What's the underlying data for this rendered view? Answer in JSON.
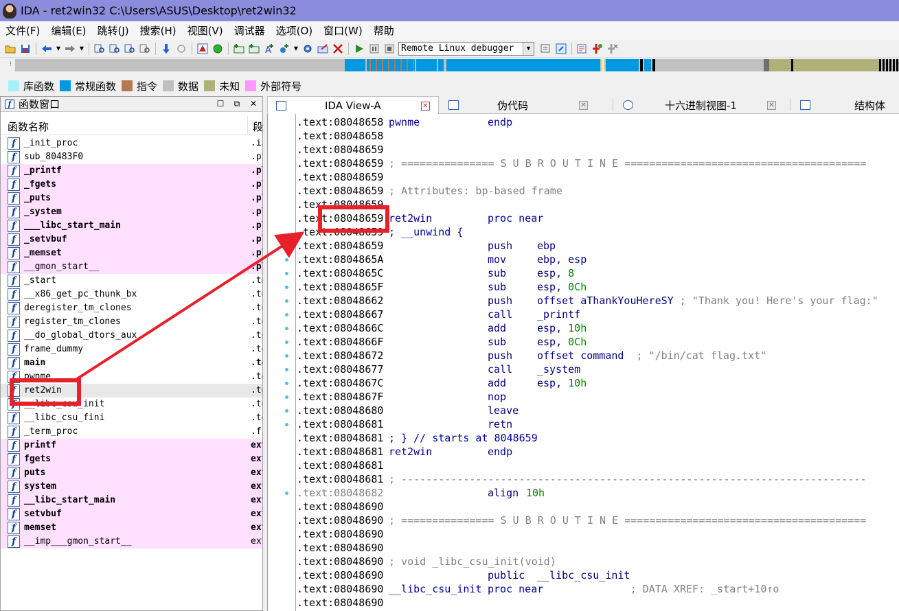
{
  "window": {
    "title": "IDA - ret2win32 C:\\Users\\ASUS\\Desktop\\ret2win32"
  },
  "menu": [
    "文件(F)",
    "编辑(E)",
    "跳转(J)",
    "搜索(H)",
    "视图(V)",
    "调试器",
    "选项(O)",
    "窗口(W)",
    "帮助"
  ],
  "toolbar": {
    "debugger_selected": "Remote Linux debugger"
  },
  "legend": [
    {
      "label": "库函数",
      "color": "#a8f0f8"
    },
    {
      "label": "常规函数",
      "color": "#0099e0"
    },
    {
      "label": "指令",
      "color": "#b87850"
    },
    {
      "label": "数据",
      "color": "#c0c0c0"
    },
    {
      "label": "未知",
      "color": "#b0b078"
    },
    {
      "label": "外部符号",
      "color": "#ff99ff"
    }
  ],
  "functions_window": {
    "title": "函数窗口",
    "col_name": "函数名称",
    "col_segment": "段",
    "rows": [
      {
        "name": "_init_proc",
        "segment": ".init",
        "kind": "normal"
      },
      {
        "name": "sub_80483F0",
        "segment": ".plt",
        "kind": "normal"
      },
      {
        "name": "_printf",
        "segment": ".plt",
        "kind": "lib"
      },
      {
        "name": "_fgets",
        "segment": ".plt",
        "kind": "lib"
      },
      {
        "name": "_puts",
        "segment": ".plt",
        "kind": "lib"
      },
      {
        "name": "_system",
        "segment": ".plt",
        "kind": "lib"
      },
      {
        "name": "___libc_start_main",
        "segment": ".plt",
        "kind": "lib"
      },
      {
        "name": "_setvbuf",
        "segment": ".plt",
        "kind": "lib"
      },
      {
        "name": "_memset",
        "segment": ".plt",
        "kind": "lib"
      },
      {
        "name": "__gmon_start__",
        "segment": ".plt",
        "kind": "libnb"
      },
      {
        "name": "_start",
        "segment": ".text",
        "kind": "normal"
      },
      {
        "name": "__x86_get_pc_thunk_bx",
        "segment": ".text",
        "kind": "normal"
      },
      {
        "name": "deregister_tm_clones",
        "segment": ".text",
        "kind": "normal"
      },
      {
        "name": "register_tm_clones",
        "segment": ".text",
        "kind": "normal"
      },
      {
        "name": "__do_global_dtors_aux",
        "segment": ".text",
        "kind": "normal"
      },
      {
        "name": "frame_dummy",
        "segment": ".text",
        "kind": "normal"
      },
      {
        "name": "main",
        "segment": ".text",
        "kind": "bold"
      },
      {
        "name": "pwnme",
        "segment": ".text",
        "kind": "normal"
      },
      {
        "name": "ret2win",
        "segment": ".text",
        "kind": "selected"
      },
      {
        "name": "__libc_csu_init",
        "segment": ".text",
        "kind": "normal"
      },
      {
        "name": "__libc_csu_fini",
        "segment": ".text",
        "kind": "normal"
      },
      {
        "name": "_term_proc",
        "segment": ".fini",
        "kind": "normal"
      },
      {
        "name": "printf",
        "segment": "extern",
        "kind": "ext"
      },
      {
        "name": "fgets",
        "segment": "extern",
        "kind": "ext"
      },
      {
        "name": "puts",
        "segment": "extern",
        "kind": "ext"
      },
      {
        "name": "system",
        "segment": "extern",
        "kind": "ext"
      },
      {
        "name": "__libc_start_main",
        "segment": "extern",
        "kind": "ext"
      },
      {
        "name": "setvbuf",
        "segment": "extern",
        "kind": "ext"
      },
      {
        "name": "memset",
        "segment": "extern",
        "kind": "ext"
      },
      {
        "name": "__imp___gmon_start__",
        "segment": "extern",
        "kind": "extnb"
      }
    ]
  },
  "tabs": [
    {
      "label": "IDA View-A",
      "active": true
    },
    {
      "label": "伪代码",
      "active": false
    },
    {
      "label": "十六进制视图-1",
      "active": false
    },
    {
      "label": "结构体",
      "active": false
    }
  ],
  "disasm": [
    {
      "addr": ".text:08048658",
      "label": "pwnme",
      "mnem": "endp"
    },
    {
      "addr": ".text:08048658"
    },
    {
      "addr": ".text:08048659"
    },
    {
      "addr": ".text:08048659",
      "comment": "; =============== S U B R O U T I N E ======================================="
    },
    {
      "addr": ".text:08048659"
    },
    {
      "addr": ".text:08048659",
      "comment": "; Attributes: bp-based frame"
    },
    {
      "addr": ".text:08048659"
    },
    {
      "addr": ".text:08048659",
      "label": "ret2win",
      "mnem": "proc near"
    },
    {
      "addr": ".text:08048659",
      "blue": "; __unwind {"
    },
    {
      "addr": ".text:08048659",
      "dot": true,
      "mnem": "push",
      "op": "ebp"
    },
    {
      "addr": ".text:0804865A",
      "dot": true,
      "mnem": "mov",
      "op": "ebp, esp"
    },
    {
      "addr": ".text:0804865C",
      "dot": true,
      "mnem": "sub",
      "op": "esp, ",
      "num": "8"
    },
    {
      "addr": ".text:0804865F",
      "dot": true,
      "mnem": "sub",
      "op": "esp, ",
      "num": "0Ch"
    },
    {
      "addr": ".text:08048662",
      "dot": true,
      "mnem": "push",
      "op": "offset aThankYouHereSY",
      "cmt": " ; \"Thank you! Here's your flag:\""
    },
    {
      "addr": ".text:08048667",
      "dot": true,
      "mnem": "call",
      "op": "_printf"
    },
    {
      "addr": ".text:0804866C",
      "dot": true,
      "mnem": "add",
      "op": "esp, ",
      "num": "10h"
    },
    {
      "addr": ".text:0804866F",
      "dot": true,
      "mnem": "sub",
      "op": "esp, ",
      "num": "0Ch"
    },
    {
      "addr": ".text:08048672",
      "dot": true,
      "mnem": "push",
      "op": "offset command",
      "cmt": "  ; \"/bin/cat flag.txt\""
    },
    {
      "addr": ".text:08048677",
      "dot": true,
      "mnem": "call",
      "op": "_system"
    },
    {
      "addr": ".text:0804867C",
      "dot": true,
      "mnem": "add",
      "op": "esp, ",
      "num": "10h"
    },
    {
      "addr": ".text:0804867F",
      "dot": true,
      "mnem": "nop"
    },
    {
      "addr": ".text:08048680",
      "dot": true,
      "mnem": "leave"
    },
    {
      "addr": ".text:08048681",
      "dot": true,
      "mnem": "retn"
    },
    {
      "addr": ".text:08048681",
      "blue": "; } // starts at 8048659"
    },
    {
      "addr": ".text:08048681",
      "label": "ret2win",
      "mnem": "endp"
    },
    {
      "addr": ".text:08048681"
    },
    {
      "addr": ".text:08048681",
      "comment": "; ---------------------------------------------------------------------------"
    },
    {
      "addr": ".text:08048682",
      "grey": true,
      "dot": true,
      "mnem": "align",
      "num_only": "10h"
    },
    {
      "addr": ".text:08048690"
    },
    {
      "addr": ".text:08048690",
      "comment": "; =============== S U B R O U T I N E ======================================="
    },
    {
      "addr": ".text:08048690"
    },
    {
      "addr": ".text:08048690"
    },
    {
      "addr": ".text:08048690",
      "comment": "; void _libc_csu_init(void)"
    },
    {
      "addr": ".text:08048690",
      "mnem": "public",
      "op": "__libc_csu_init"
    },
    {
      "addr": ".text:08048690",
      "label": "__libc_csu_init",
      "mnem": "proc near",
      "cmt": "              ; DATA XREF: _start+10↑o"
    },
    {
      "addr": ".text:08048690"
    }
  ]
}
